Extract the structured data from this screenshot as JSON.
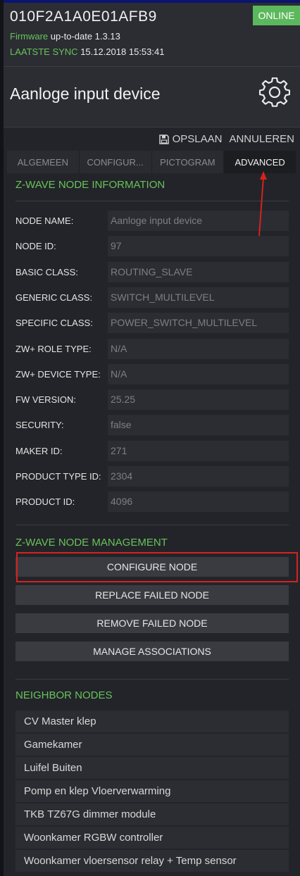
{
  "header": {
    "device_id": "010F2A1A0E01AFB9",
    "status": "ONLINE",
    "firmware_label": "Firmware",
    "firmware_value": "up-to-date 1.3.13",
    "sync_label": "LAATSTE SYNC",
    "sync_value": "15.12.2018 15:53:41",
    "device_name": "Aanloge input device"
  },
  "actions": {
    "save": "OPSLAAN",
    "cancel": "ANNULEREN"
  },
  "tabs": [
    "ALGEMEEN",
    "CONFIGUR...",
    "PICTOGRAM",
    "ADVANCED"
  ],
  "node_info": {
    "title": "Z-WAVE NODE INFORMATION",
    "rows": [
      {
        "label": "NODE NAME:",
        "value": "Aanloge input device"
      },
      {
        "label": "NODE ID:",
        "value": "97"
      },
      {
        "label": "BASIC CLASS:",
        "value": "ROUTING_SLAVE"
      },
      {
        "label": "GENERIC CLASS:",
        "value": "SWITCH_MULTILEVEL"
      },
      {
        "label": "SPECIFIC CLASS:",
        "value": "POWER_SWITCH_MULTILEVEL"
      },
      {
        "label": "ZW+ ROLE TYPE:",
        "value": "N/A"
      },
      {
        "label": "ZW+ DEVICE TYPE:",
        "value": "N/A"
      },
      {
        "label": "FW VERSION:",
        "value": "25.25"
      },
      {
        "label": "SECURITY:",
        "value": "false"
      },
      {
        "label": "MAKER ID:",
        "value": "271"
      },
      {
        "label": "PRODUCT TYPE ID:",
        "value": "2304"
      },
      {
        "label": "PRODUCT ID:",
        "value": "4096"
      }
    ]
  },
  "node_management": {
    "title": "Z-WAVE NODE MANAGEMENT",
    "buttons": [
      "CONFIGURE NODE",
      "REPLACE FAILED NODE",
      "REMOVE FAILED NODE",
      "MANAGE ASSOCIATIONS"
    ]
  },
  "neighbors": {
    "title": "NEIGHBOR NODES",
    "items": [
      "CV Master klep",
      "Gamekamer",
      "Luifel Buiten",
      "Pomp en klep Vloerverwarming",
      "TKB TZ67G dimmer module",
      "Woonkamer RGBW controller",
      "Woonkamer vloersensor relay + Temp sensor"
    ]
  },
  "colors": {
    "accent_green": "#68c35a",
    "online_badge": "#5cb85c",
    "annotation_red": "#d4231d"
  },
  "icons": {
    "settings": "gear-icon",
    "save": "floppy-disk-icon"
  }
}
